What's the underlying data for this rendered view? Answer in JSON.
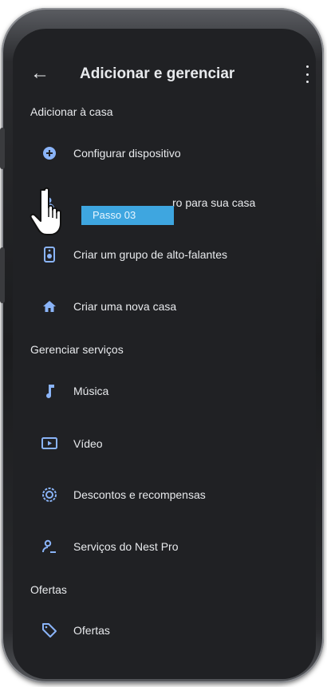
{
  "header": {
    "back_icon": "arrow-back-icon",
    "title": "Adicionar e gerenciar",
    "menu_icon": "more-vert-icon"
  },
  "sections": [
    {
      "label": "Adicionar à casa",
      "items": [
        {
          "label": "Configurar dispositivo",
          "icon": "add-circle-icon"
        },
        {
          "label": "ro para sua casa",
          "icon": "person-add-icon"
        },
        {
          "label": "Criar um grupo de alto-falantes",
          "icon": "speaker-group-icon"
        },
        {
          "label": "Criar uma nova casa",
          "icon": "home-icon"
        }
      ]
    },
    {
      "label": "Gerenciar serviços",
      "items": [
        {
          "label": "Música",
          "icon": "music-note-icon"
        },
        {
          "label": "Vídeo",
          "icon": "video-icon"
        },
        {
          "label": "Descontos e recompensas",
          "icon": "rewards-icon"
        },
        {
          "label": "Serviços do Nest Pro",
          "icon": "nest-pro-icon"
        }
      ]
    },
    {
      "label": "Ofertas",
      "items": [
        {
          "label": "Ofertas",
          "icon": "tag-icon"
        }
      ]
    }
  ],
  "overlay": {
    "tooltip": "Passo 03",
    "cursor_icon": "hand-pointer-icon"
  },
  "colors": {
    "background": "#202124",
    "text": "#e8eaed",
    "icon": "#8ab4f8",
    "tooltip": "#3ea6e0"
  }
}
